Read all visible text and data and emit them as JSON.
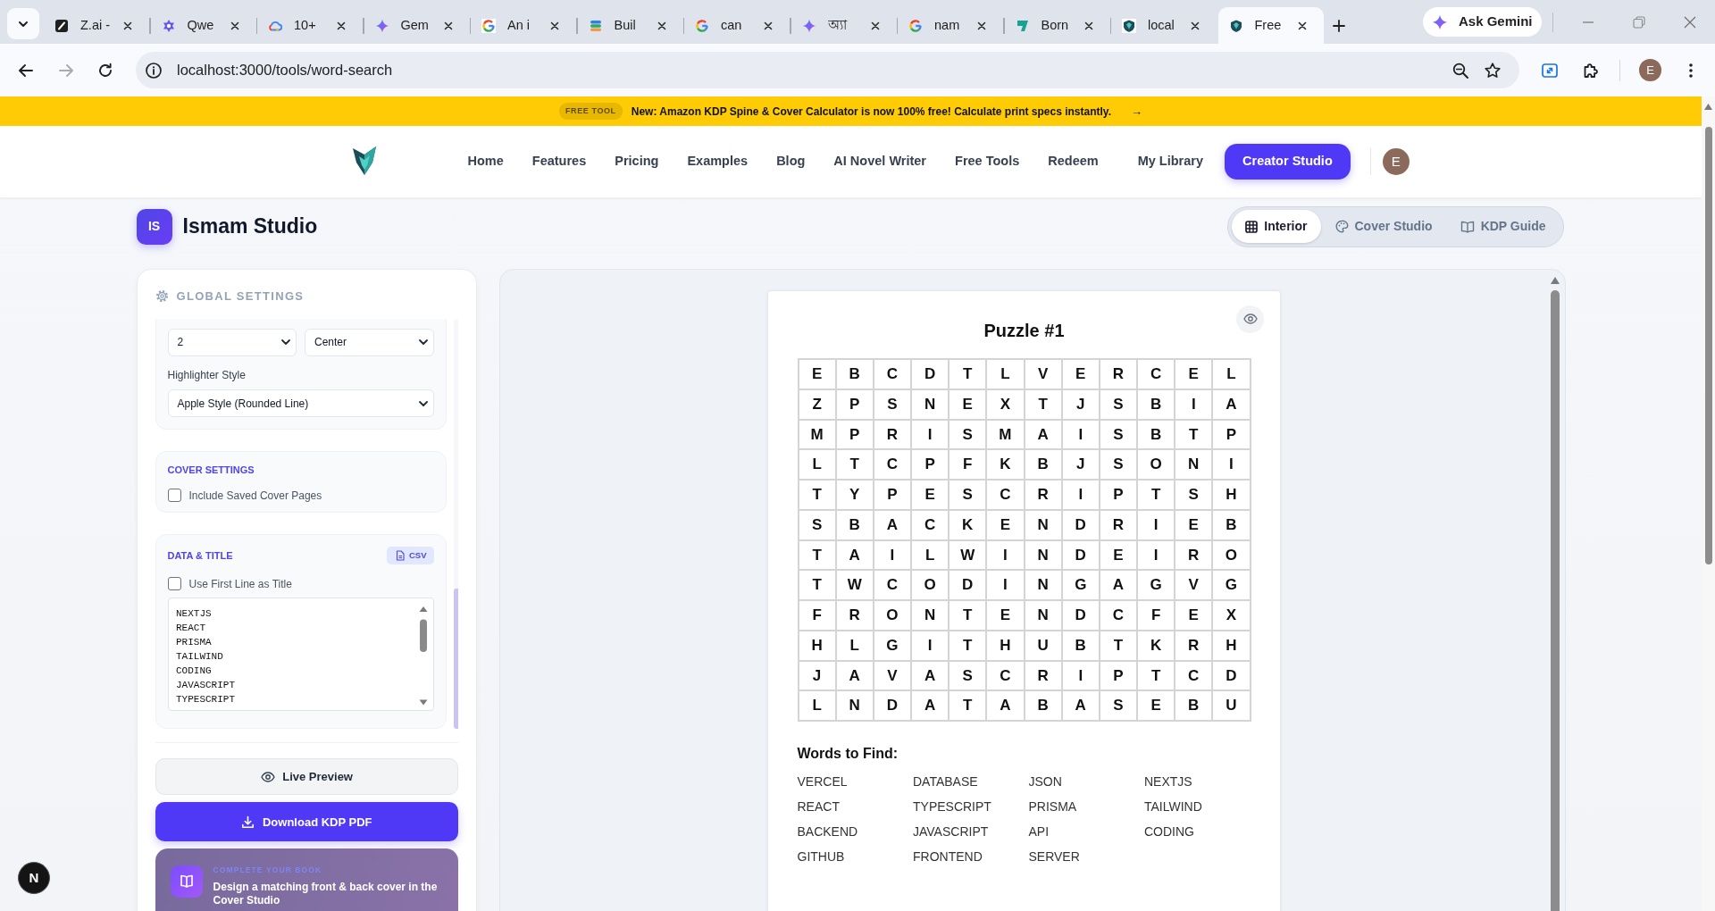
{
  "browser": {
    "tabs": [
      {
        "title": "Z.ai -",
        "selected": false
      },
      {
        "title": "Qwe",
        "selected": false
      },
      {
        "title": "10+",
        "selected": false
      },
      {
        "title": "Gem",
        "selected": false
      },
      {
        "title": "An i",
        "selected": false
      },
      {
        "title": "Buil",
        "selected": false
      },
      {
        "title": "can",
        "selected": false
      },
      {
        "title": "অ্যা",
        "selected": false
      },
      {
        "title": "nam",
        "selected": false
      },
      {
        "title": "Born",
        "selected": false
      },
      {
        "title": "local",
        "selected": false
      },
      {
        "title": "Free",
        "selected": true
      }
    ],
    "ask_gemini": "Ask Gemini",
    "forward_disabled": true,
    "url": "localhost:3000/tools/word-search",
    "profile_initial": "E"
  },
  "banner": {
    "tag": "FREE TOOL",
    "text": "New: Amazon KDP Spine & Cover Calculator is now 100% free! Calculate print specs instantly.",
    "arrow": "→"
  },
  "navbar": {
    "links": [
      "Home",
      "Features",
      "Pricing",
      "Examples",
      "Blog",
      "AI Novel Writer",
      "Free Tools",
      "Redeem"
    ],
    "account_links": [
      "My Library"
    ],
    "cta": "Creator Studio",
    "avatar_initial": "E"
  },
  "header": {
    "badge": "IS",
    "title": "Ismam Studio",
    "modes": [
      {
        "label": "Interior",
        "selected": true
      },
      {
        "label": "Cover Studio",
        "selected": false
      },
      {
        "label": "KDP Guide",
        "selected": false
      }
    ]
  },
  "settings": {
    "title": "GLOBAL SETTINGS",
    "layout_selects": [
      "2",
      "Center"
    ],
    "highlighter": {
      "label": "Highlighter Style",
      "value": "Apple Style (Rounded Line)"
    },
    "cover_section": {
      "title": "COVER SETTINGS",
      "options": [
        {
          "label": "Include Saved Cover Pages",
          "checked": false
        }
      ]
    },
    "data_section": {
      "title": "DATA & TITLE",
      "csv_button": "CSV",
      "options": [
        {
          "label": "Use First Line as Title",
          "checked": false
        }
      ],
      "word_list": [
        "NEXTJS",
        "REACT",
        "PRISMA",
        "TAILWIND",
        "CODING",
        "JAVASCRIPT",
        "TYPESCRIPT"
      ]
    },
    "live_preview_button": "Live Preview",
    "download_button": "Download KDP PDF",
    "promo": {
      "kicker": "COMPLETE YOUR BOOK",
      "text": "Design a matching front & back cover in the Cover Studio"
    }
  },
  "preview": {
    "title": "Puzzle #1",
    "grid": [
      [
        "E",
        "B",
        "C",
        "D",
        "T",
        "L",
        "V",
        "E",
        "R",
        "C",
        "E",
        "L"
      ],
      [
        "Z",
        "P",
        "S",
        "N",
        "E",
        "X",
        "T",
        "J",
        "S",
        "B",
        "I",
        "A"
      ],
      [
        "M",
        "P",
        "R",
        "I",
        "S",
        "M",
        "A",
        "I",
        "S",
        "B",
        "T",
        "P"
      ],
      [
        "L",
        "T",
        "C",
        "P",
        "F",
        "K",
        "B",
        "J",
        "S",
        "O",
        "N",
        "I"
      ],
      [
        "T",
        "Y",
        "P",
        "E",
        "S",
        "C",
        "R",
        "I",
        "P",
        "T",
        "S",
        "H"
      ],
      [
        "S",
        "B",
        "A",
        "C",
        "K",
        "E",
        "N",
        "D",
        "R",
        "I",
        "E",
        "B"
      ],
      [
        "T",
        "A",
        "I",
        "L",
        "W",
        "I",
        "N",
        "D",
        "E",
        "I",
        "R",
        "O"
      ],
      [
        "T",
        "W",
        "C",
        "O",
        "D",
        "I",
        "N",
        "G",
        "A",
        "G",
        "V",
        "G"
      ],
      [
        "F",
        "R",
        "O",
        "N",
        "T",
        "E",
        "N",
        "D",
        "C",
        "F",
        "E",
        "X"
      ],
      [
        "H",
        "L",
        "G",
        "I",
        "T",
        "H",
        "U",
        "B",
        "T",
        "K",
        "R",
        "H"
      ],
      [
        "J",
        "A",
        "V",
        "A",
        "S",
        "C",
        "R",
        "I",
        "P",
        "T",
        "C",
        "D"
      ],
      [
        "L",
        "N",
        "D",
        "A",
        "T",
        "A",
        "B",
        "A",
        "S",
        "E",
        "B",
        "U"
      ]
    ],
    "words_heading": "Words to Find:",
    "words": [
      "VERCEL",
      "DATABASE",
      "JSON",
      "NEXTJS",
      "REACT",
      "TYPESCRIPT",
      "PRISMA",
      "TAILWIND",
      "BACKEND",
      "JAVASCRIPT",
      "API",
      "CODING",
      "GITHUB",
      "FRONTEND",
      "SERVER"
    ]
  },
  "dev_badge": "N"
}
